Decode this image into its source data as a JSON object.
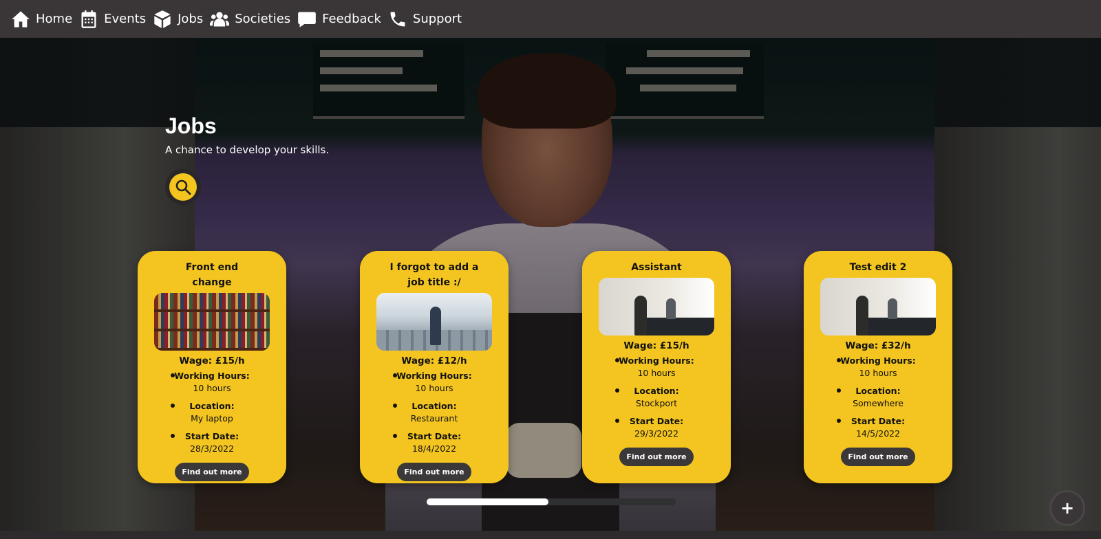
{
  "nav": {
    "items": [
      {
        "label": "Home",
        "icon": "home-icon"
      },
      {
        "label": "Events",
        "icon": "calendar-icon"
      },
      {
        "label": "Jobs",
        "icon": "box-icon"
      },
      {
        "label": "Societies",
        "icon": "users-icon"
      },
      {
        "label": "Feedback",
        "icon": "comment-icon"
      },
      {
        "label": "Support",
        "icon": "phone-icon"
      }
    ]
  },
  "hero": {
    "title": "Jobs",
    "subtitle": "A chance to develop your skills."
  },
  "colors": {
    "accent": "#f4c520",
    "nav_bg": "#3a3637",
    "button_dark": "#3b3839"
  },
  "cards": [
    {
      "title": "Front end change",
      "image": "library-bookshelf-image",
      "wage": "Wage: £15/h",
      "hours_label": "Working Hours:",
      "hours": "10 hours",
      "location_label": "Location:",
      "location": "My laptop",
      "start_label": "Start Date:",
      "start": "28/3/2022",
      "button": "Find out more"
    },
    {
      "title": "I forgot to add a job title :/",
      "image": "airplane-cabin-image",
      "wage": "Wage: £12/h",
      "hours_label": "Working Hours:",
      "hours": "10 hours",
      "location_label": "Location:",
      "location": "Restaurant",
      "start_label": "Start Date:",
      "start": "18/4/2022",
      "button": "Find out more"
    },
    {
      "title": "Assistant",
      "image": "shop-counter-image",
      "wage": "Wage: £15/h",
      "hours_label": "Working Hours:",
      "hours": "10 hours",
      "location_label": "Location:",
      "location": "Stockport",
      "start_label": "Start Date:",
      "start": "29/3/2022",
      "button": "Find out more"
    },
    {
      "title": "Test edit 2",
      "image": "shop-counter-image",
      "wage": "Wage: £32/h",
      "hours_label": "Working Hours:",
      "hours": "10 hours",
      "location_label": "Location:",
      "location": "Somewhere",
      "start_label": "Start Date:",
      "start": "14/5/2022",
      "button": "Find out more"
    }
  ],
  "scroll": {
    "progress": 0.49
  },
  "fab": {
    "label": "+"
  }
}
